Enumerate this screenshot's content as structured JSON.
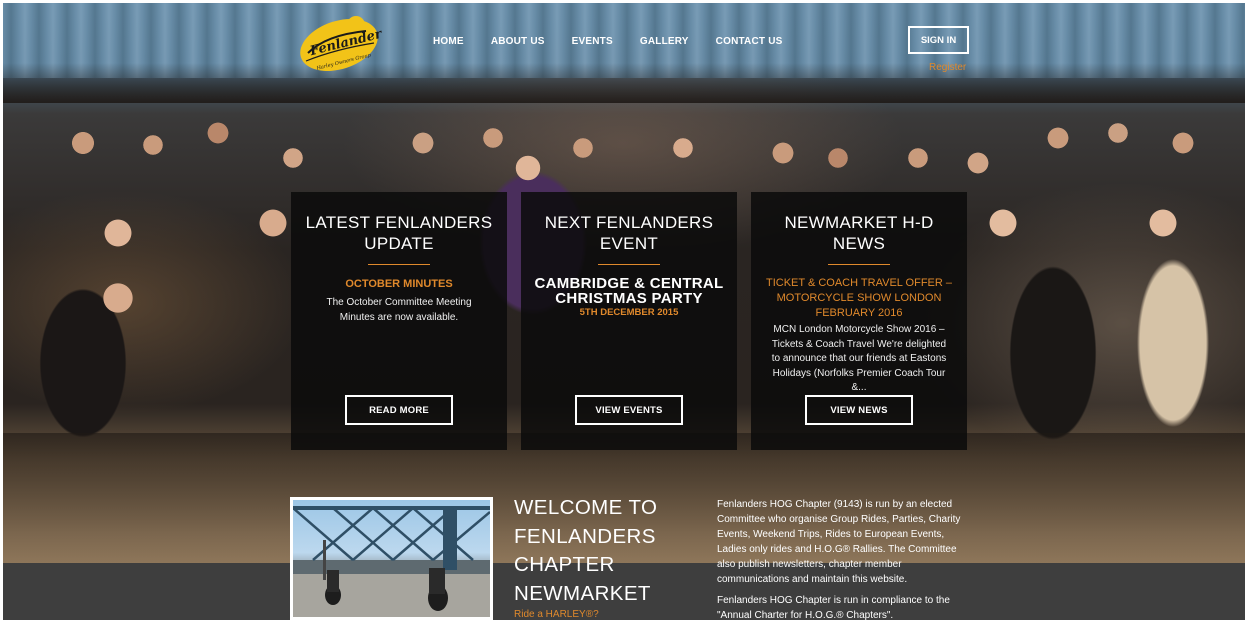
{
  "nav": {
    "items": [
      "HOME",
      "ABOUT US",
      "EVENTS",
      "GALLERY",
      "CONTACT US"
    ],
    "sign_in": "SIGN IN",
    "register": "Register"
  },
  "logo": {
    "text": "Fenlanders",
    "subtext": "Harley Owners Group"
  },
  "panels": [
    {
      "title": "LATEST FENLANDERS UPDATE",
      "subtitle": "OCTOBER MINUTES",
      "body": "The October Committee Meeting Minutes are now available.",
      "button": "READ MORE"
    },
    {
      "title": "NEXT FENLANDERS EVENT",
      "event_title": "CAMBRIDGE & CENTRAL CHRISTMAS PARTY",
      "event_date": "5TH DECEMBER 2015",
      "button": "VIEW EVENTS"
    },
    {
      "title": "NEWMARKET H-D NEWS",
      "subtitle": "TICKET & COACH TRAVEL OFFER – MOTORCYCLE SHOW LONDON FEBRUARY 2016",
      "body": "MCN London Motorcycle Show 2016 – Tickets & Coach Travel We're delighted to announce that our friends at Eastons Holidays (Norfolks Premier Coach Tour &...",
      "button": "VIEW NEWS"
    }
  ],
  "welcome": {
    "lines": [
      "WELCOME TO",
      "FENLANDERS",
      "CHAPTER",
      "NEWMARKET"
    ],
    "link": "Ride a HARLEY®?"
  },
  "about": {
    "p1": "Fenlanders HOG Chapter (9143) is run by an elected Committee who organise Group Rides, Parties, Charity Events, Weekend Trips, Rides to European Events, Ladies only rides and H.O.G® Rallies. The Committee also publish newsletters, chapter member communications and maintain this website.",
    "p2": "Fenlanders HOG Chapter is run in compliance to the \"Annual Charter for H.O.G.® Chapters\"."
  },
  "colors": {
    "accent": "#e0892c",
    "panel_bg": "#0a0a0a",
    "band_bg": "#3e3e3e"
  }
}
